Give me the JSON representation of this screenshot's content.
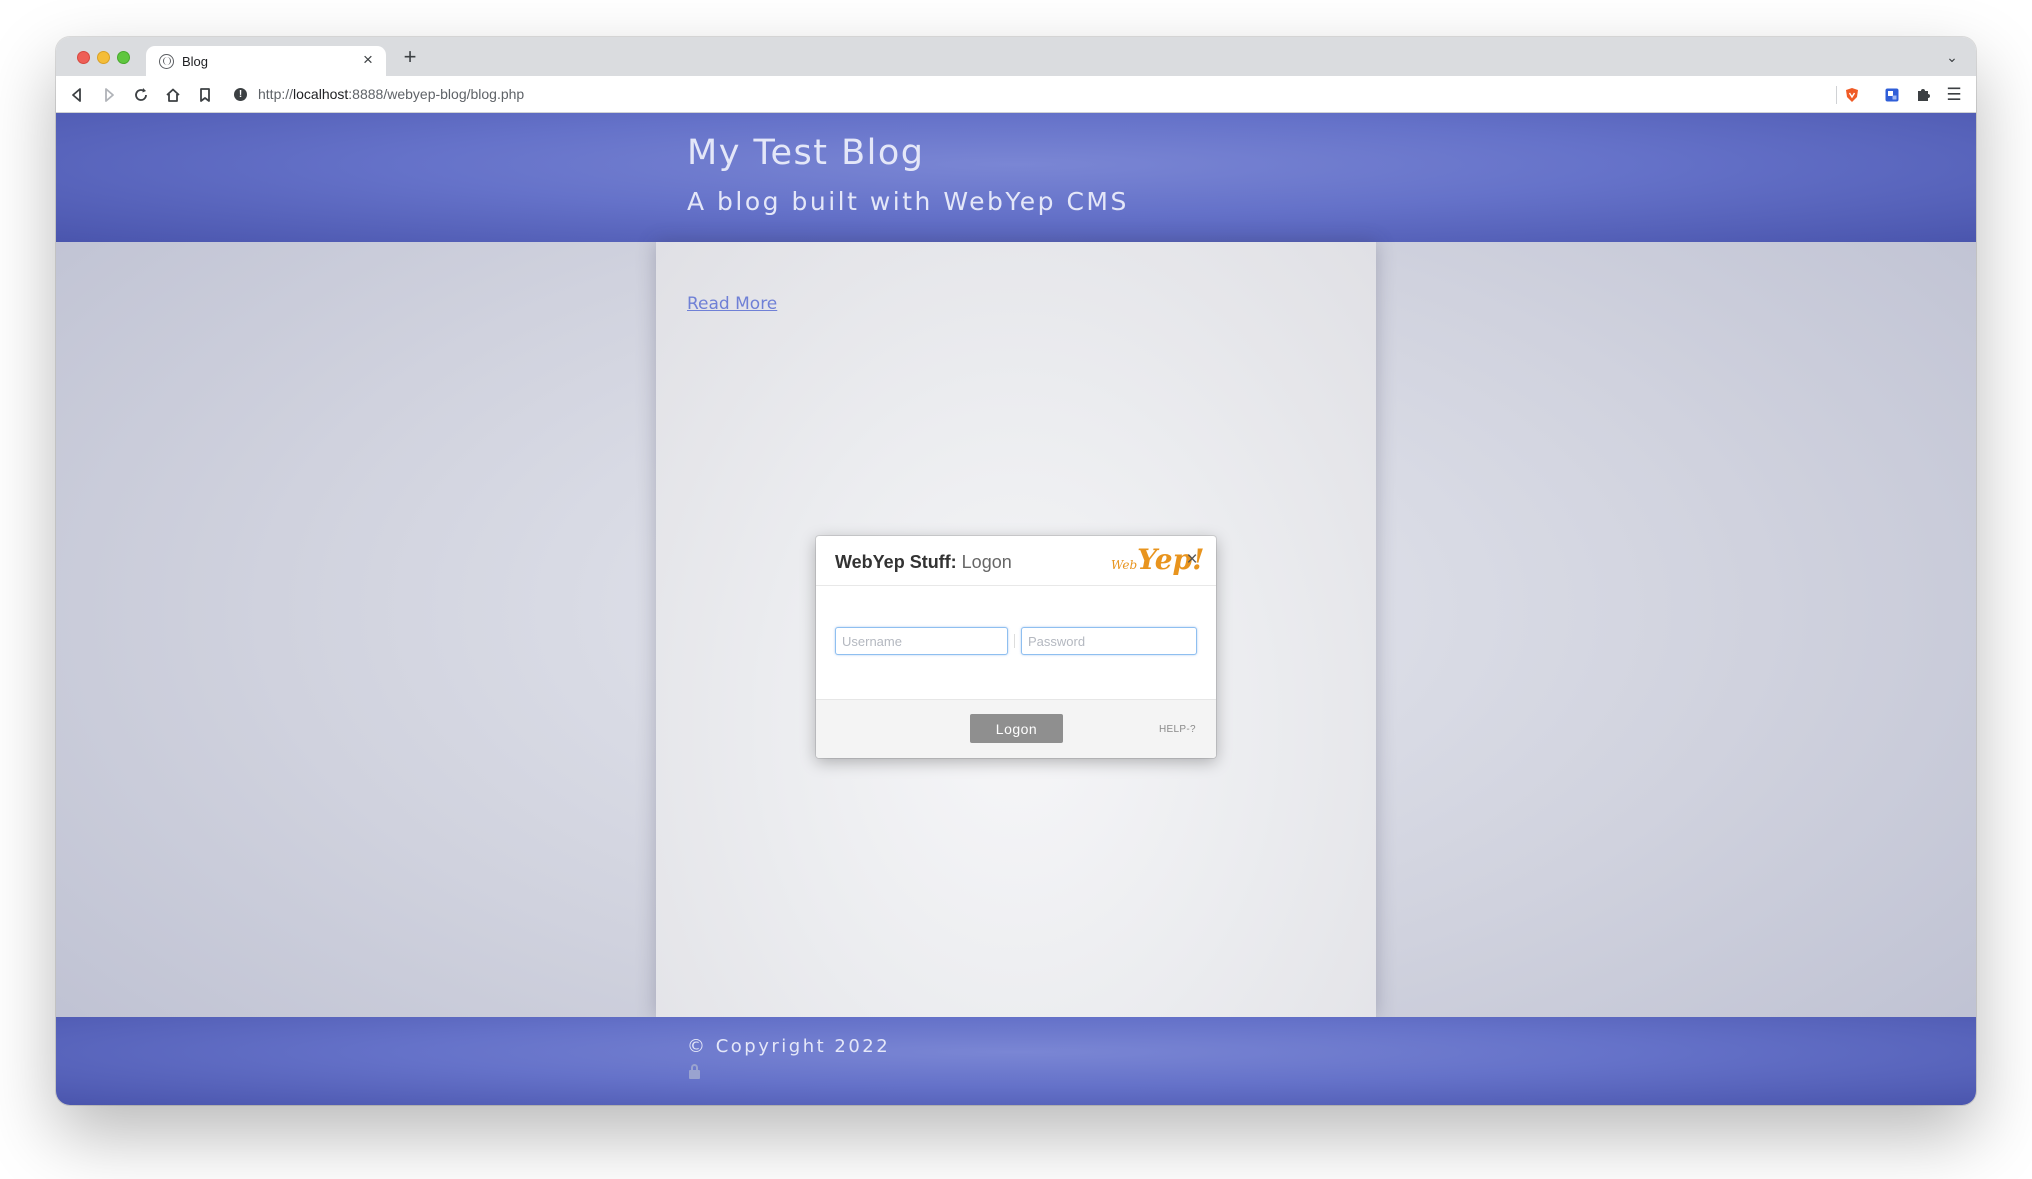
{
  "browser": {
    "tab": {
      "title": "Blog",
      "close_glyph": "×"
    },
    "new_tab_glyph": "+",
    "tab_menu_glyph": "⌄",
    "url": {
      "prefix": "http://",
      "host": "localhost",
      "rest": ":8888/webyep-blog/blog.php"
    },
    "info_glyph": "!",
    "icons": [
      "back-icon",
      "forward-icon",
      "reload-icon",
      "home-icon",
      "bookmark-icon",
      "site-info-icon",
      "brave-shield-icon",
      "extension-icon",
      "puzzle-icon",
      "menu-icon"
    ],
    "menu_glyph": "☰"
  },
  "site": {
    "title": "My Test Blog",
    "subtitle": "A blog built with WebYep CMS",
    "read_more": "Read More",
    "copyright": "© Copyright 2022"
  },
  "dialog": {
    "title_strong": "WebYep Stuff:",
    "title_light": " Logon",
    "logo_small": "Web",
    "logo_big": "Yep!",
    "close_glyph": "×",
    "username_placeholder": "Username",
    "password_placeholder": "Password",
    "logon_label": "Logon",
    "help_label": "HELP-?"
  },
  "colors": {
    "header_blue": "#6572c9",
    "link": "#6f80d6",
    "logo_orange": "#e8941e",
    "logon_button": "#8f8f8f"
  }
}
